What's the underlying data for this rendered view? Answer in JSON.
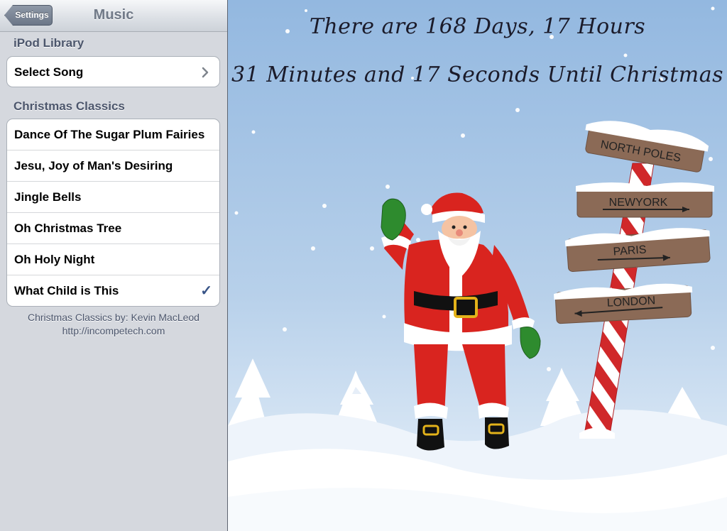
{
  "nav": {
    "back_label": "Settings",
    "title": "Music"
  },
  "ipod_library": {
    "header": "iPod Library",
    "select_song_label": "Select Song"
  },
  "christmas_classics": {
    "header": "Christmas Classics",
    "songs": [
      {
        "title": "Dance Of The Sugar Plum Fairies",
        "selected": false
      },
      {
        "title": "Jesu, Joy of Man's Desiring",
        "selected": false
      },
      {
        "title": "Jingle Bells",
        "selected": false
      },
      {
        "title": "Oh Christmas Tree",
        "selected": false
      },
      {
        "title": "Oh Holy Night",
        "selected": false
      },
      {
        "title": "What Child is This",
        "selected": true
      }
    ]
  },
  "footer": {
    "credit": "Christmas Classics by: Kevin MacLeod",
    "url": "http://incompetech.com"
  },
  "countdown": {
    "line1": "There are 168 Days, 17 Hours",
    "line2": "31 Minutes and 17 Seconds Until Christmas"
  },
  "signpost": {
    "signs": [
      "NORTH POLES",
      "NEWYORK",
      "PARIS",
      "LONDON"
    ]
  },
  "colors": {
    "sky_top": "#93b8e0",
    "checkmark": "#385487",
    "santa_red": "#d9241f",
    "mitten_green": "#2e8b2e"
  },
  "icons": {
    "back": "back-arrow-button",
    "chevron": "chevron-right-icon",
    "check": "checkmark-icon"
  }
}
